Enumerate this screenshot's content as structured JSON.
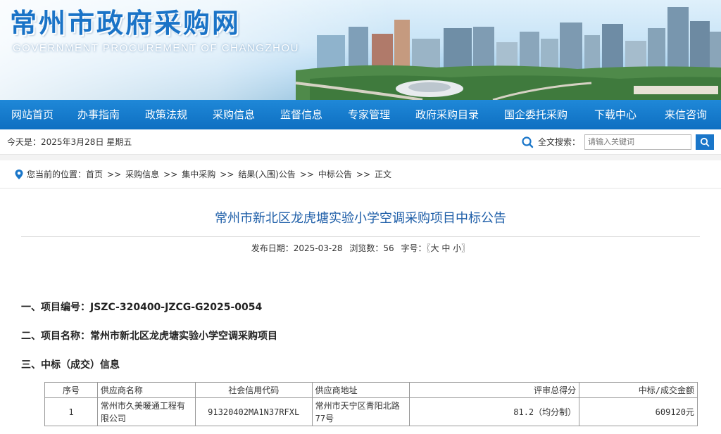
{
  "header": {
    "title_cn": "常州市政府采购网",
    "title_en": "GOVERNMENT PROCUREMENT OF CHANGZHOU"
  },
  "nav": {
    "items": [
      "网站首页",
      "办事指南",
      "政策法规",
      "采购信息",
      "监督信息",
      "专家管理",
      "政府采购目录",
      "国企委托采购",
      "下载中心",
      "来信咨询"
    ]
  },
  "infobar": {
    "date": "今天是：2025年3月28日 星期五",
    "search_label": "全文搜索：",
    "search_placeholder": "请输入关键词"
  },
  "breadcrumb": {
    "prefix": "您当前的位置：",
    "items": [
      "首页",
      "采购信息",
      "集中采购",
      "结果(入围)公告",
      "中标公告",
      "正文"
    ],
    "separator": ">>"
  },
  "article": {
    "title": "常州市新北区龙虎塘实验小学空调采购项目中标公告",
    "publish_label": "发布日期：",
    "publish_date": "2025-03-28",
    "views_label": "浏览数：",
    "views": "56",
    "font_label": "字号：",
    "font_open": "〖",
    "font_large": "大",
    "font_medium": "中",
    "font_small": "小",
    "font_close": "〗",
    "sec1": "一、项目编号：JSZC-320400-JZCG-G2025-0054",
    "sec2": "二、项目名称：常州市新北区龙虎塘实验小学空调采购项目",
    "sec3": "三、中标（成交）信息"
  },
  "table": {
    "headers": [
      "序号",
      "供应商名称",
      "社会信用代码",
      "供应商地址",
      "评审总得分",
      "中标/成交金额"
    ],
    "rows": [
      [
        "1",
        "常州市久美暖通工程有限公司",
        "91320402MA1N37RFXL",
        "常州市天宁区青阳北路77号",
        "81.2（均分制）",
        "609120元"
      ]
    ]
  },
  "colors": {
    "nav_bg": "#0e6fc1",
    "title_blue": "#1e5ea8",
    "accent": "#1a76c9"
  }
}
